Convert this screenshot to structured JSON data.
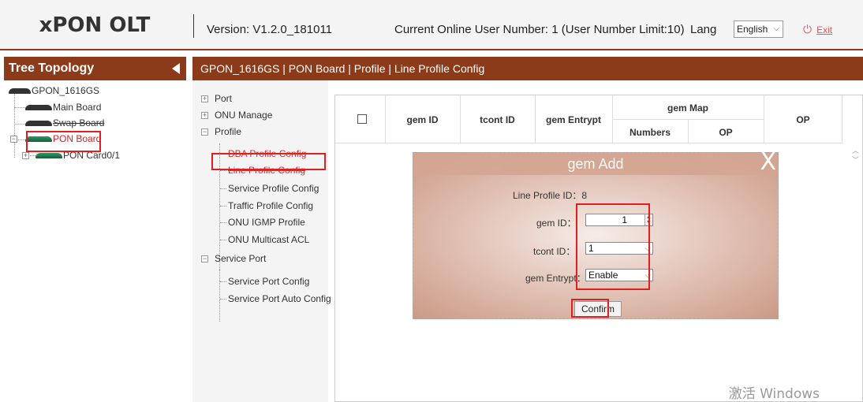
{
  "header": {
    "app_title": "xPON OLT",
    "version": "Version: V1.2.0_181011",
    "online_users": "Current Online User Number: 1 (User Number Limit:10)",
    "lang_label": "Lang",
    "lang_value": "English",
    "exit_label": "Exit"
  },
  "tree": {
    "title": "Tree Topology",
    "nodes": [
      "GPON_1616GS",
      "Main Board",
      "Swap Board",
      "PON Board",
      "PON Card0/1"
    ]
  },
  "breadcrumb": "GPON_1616GS | PON Board | Profile | Line Profile Config",
  "nav": {
    "port": "Port",
    "onu_manage": "ONU Manage",
    "profile": "Profile",
    "profile_items": [
      "DBA Profile Config",
      "Line Profile Config",
      "Service Profile Config",
      "Traffic Profile Config",
      "ONU IGMP Profile",
      "ONU Multicast ACL"
    ],
    "service_port": "Service Port",
    "service_items": [
      "Service Port Config",
      "Service Port Auto Config"
    ]
  },
  "grid": {
    "headers": {
      "gem_id": "gem ID",
      "tcont_id": "tcont ID",
      "gem_entrypt": "gem Entrypt",
      "gem_map": "gem Map",
      "numbers": "Numbers",
      "op_sub": "OP",
      "op": "OP"
    }
  },
  "modal": {
    "title": "gem Add",
    "close": "X",
    "line_profile_id": "Line Profile ID：8",
    "gem_id_label": "gem ID：",
    "gem_id_value": "1",
    "tcont_id_label": "tcont ID：",
    "tcont_id_value": "1",
    "gem_entrypt_label": "gem Entrypt：",
    "gem_entrypt_value": "Enable",
    "confirm": "Confirm"
  },
  "watermark": "激活 Windows",
  "colors": {
    "brand": "#8b3a1a",
    "highlight": "#e02020"
  }
}
